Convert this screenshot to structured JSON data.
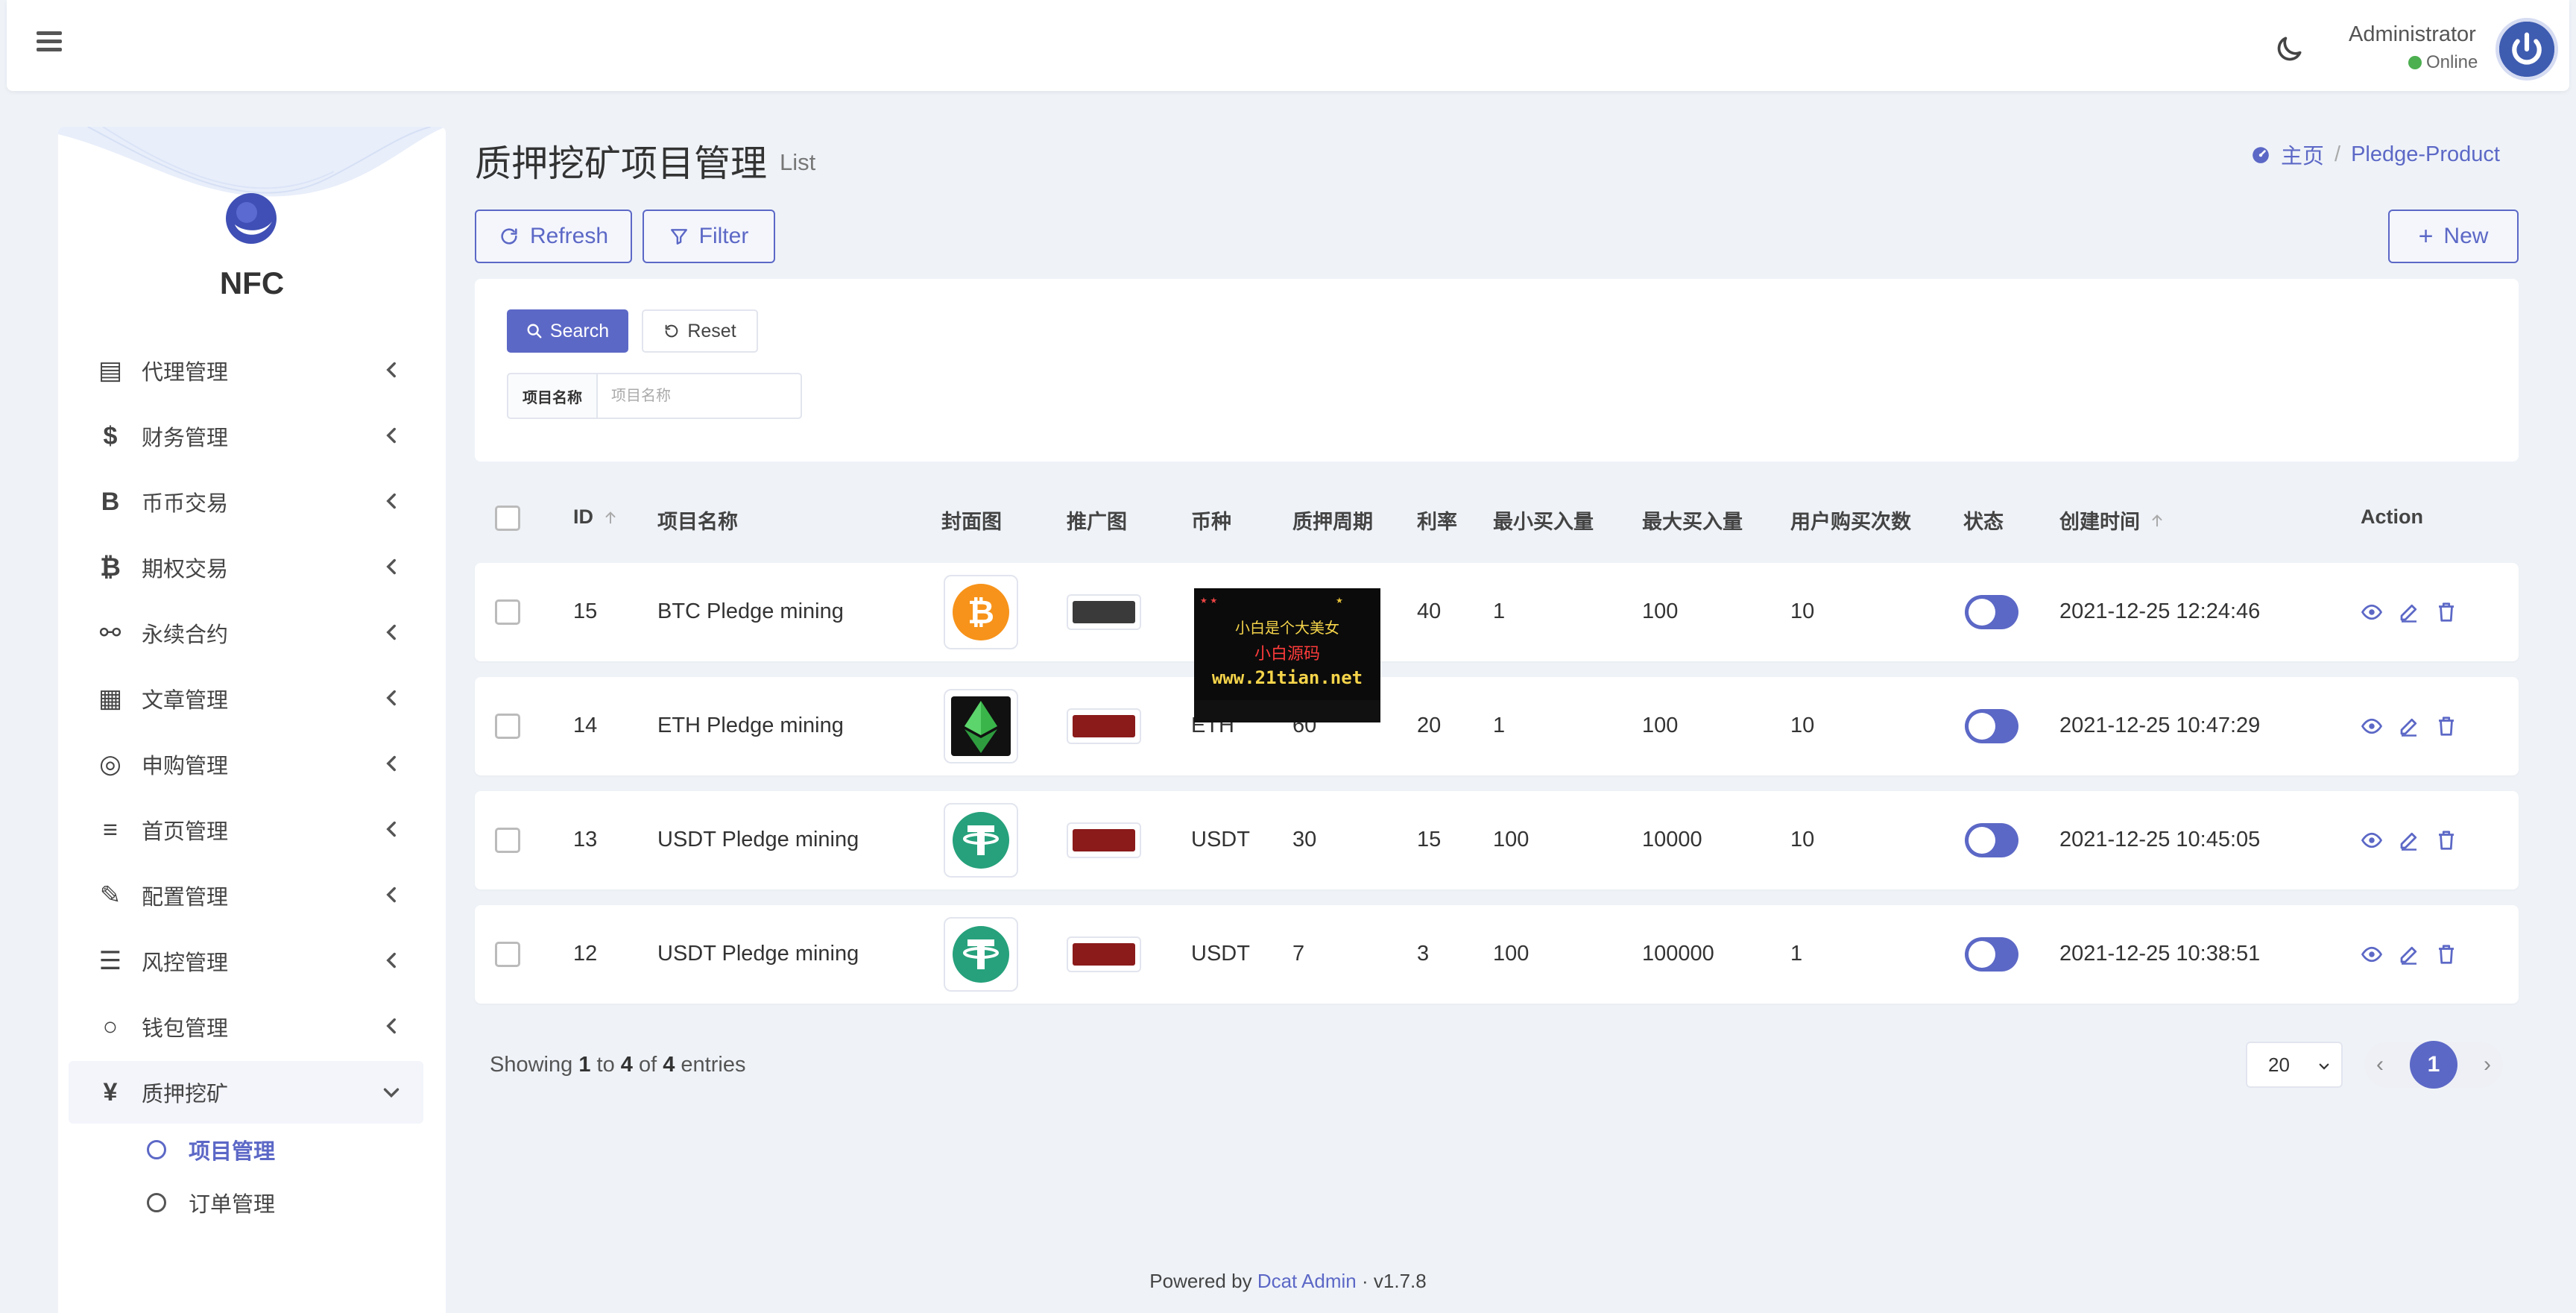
{
  "header": {
    "user_name": "Administrator",
    "user_status": "Online"
  },
  "brand": {
    "name": "NFC"
  },
  "sidebar": {
    "items": [
      {
        "icon": "id-card-icon",
        "glyph": "▤",
        "label": "代理管理"
      },
      {
        "icon": "dollar-icon",
        "glyph": "$",
        "label": "财务管理"
      },
      {
        "icon": "bitcoin-b-icon",
        "glyph": "B",
        "label": "币币交易"
      },
      {
        "icon": "bitcoin-icon",
        "glyph": "₿",
        "label": "期权交易"
      },
      {
        "icon": "link-icon",
        "glyph": "⚯",
        "label": "永续合约"
      },
      {
        "icon": "newspaper-icon",
        "glyph": "▦",
        "label": "文章管理"
      },
      {
        "icon": "life-ring-icon",
        "glyph": "◎",
        "label": "申购管理"
      },
      {
        "icon": "bars-icon",
        "glyph": "≡",
        "label": "首页管理"
      },
      {
        "icon": "wrench-icon",
        "glyph": "✎",
        "label": "配置管理"
      },
      {
        "icon": "list-icon",
        "glyph": "☰",
        "label": "风控管理"
      },
      {
        "icon": "circle-icon",
        "glyph": "○",
        "label": "钱包管理"
      },
      {
        "icon": "yen-icon",
        "glyph": "¥",
        "label": "质押挖矿"
      }
    ],
    "subitems": [
      {
        "label": "项目管理"
      },
      {
        "label": "订单管理"
      }
    ]
  },
  "page": {
    "title": "质押挖矿项目管理",
    "subtitle": "List"
  },
  "breadcrumb": {
    "home": "主页",
    "current": "Pledge-Product"
  },
  "toolbar": {
    "refresh": "Refresh",
    "filter": "Filter",
    "new": "New"
  },
  "filter": {
    "search": "Search",
    "reset": "Reset",
    "field_label": "项目名称",
    "field_placeholder": "项目名称",
    "field_value": ""
  },
  "table": {
    "headers": {
      "id": "ID",
      "name": "项目名称",
      "cover": "封面图",
      "banner": "推广图",
      "coin": "币种",
      "period": "质押周期",
      "rate": "利率",
      "min": "最小买入量",
      "max": "最大买入量",
      "times": "用户购买次数",
      "status": "状态",
      "created": "创建时间",
      "action": "Action"
    },
    "rows": [
      {
        "id": "15",
        "name": "BTC Pledge mining",
        "cover": "btc-logo",
        "coin": "",
        "period": "",
        "rate": "40",
        "min": "1",
        "max": "100",
        "times": "10",
        "status": "on",
        "created": "2021-12-25 12:24:46"
      },
      {
        "id": "14",
        "name": "ETH Pledge mining",
        "cover": "eth-logo",
        "coin": "ETH",
        "period": "60",
        "rate": "20",
        "min": "1",
        "max": "100",
        "times": "10",
        "status": "on",
        "created": "2021-12-25 10:47:29"
      },
      {
        "id": "13",
        "name": "USDT Pledge mining",
        "cover": "usdt-logo",
        "coin": "USDT",
        "period": "30",
        "rate": "15",
        "min": "100",
        "max": "10000",
        "times": "10",
        "status": "on",
        "created": "2021-12-25 10:45:05"
      },
      {
        "id": "12",
        "name": "USDT Pledge mining",
        "cover": "usdt-logo",
        "coin": "USDT",
        "period": "7",
        "rate": "3",
        "min": "100",
        "max": "100000",
        "times": "1",
        "status": "on",
        "created": "2021-12-25 10:38:51"
      }
    ]
  },
  "pagination": {
    "showing_prefix": "Showing",
    "from": "1",
    "to_word": "to",
    "to": "4",
    "of_word": "of",
    "total": "4",
    "entries_word": "entries",
    "page_size": "20",
    "current_page": "1"
  },
  "footer": {
    "powered_by": "Powered by",
    "link": "Dcat Admin",
    "version": "v1.7.8"
  },
  "overlay": {
    "line1": "小白是个大美女",
    "line2": "小白源码",
    "line3": "www.21tian.net"
  },
  "colors": {
    "primary": "#5c68c6",
    "background": "#eff3f8",
    "btc": "#f7931a",
    "usdt": "#26a17b"
  }
}
